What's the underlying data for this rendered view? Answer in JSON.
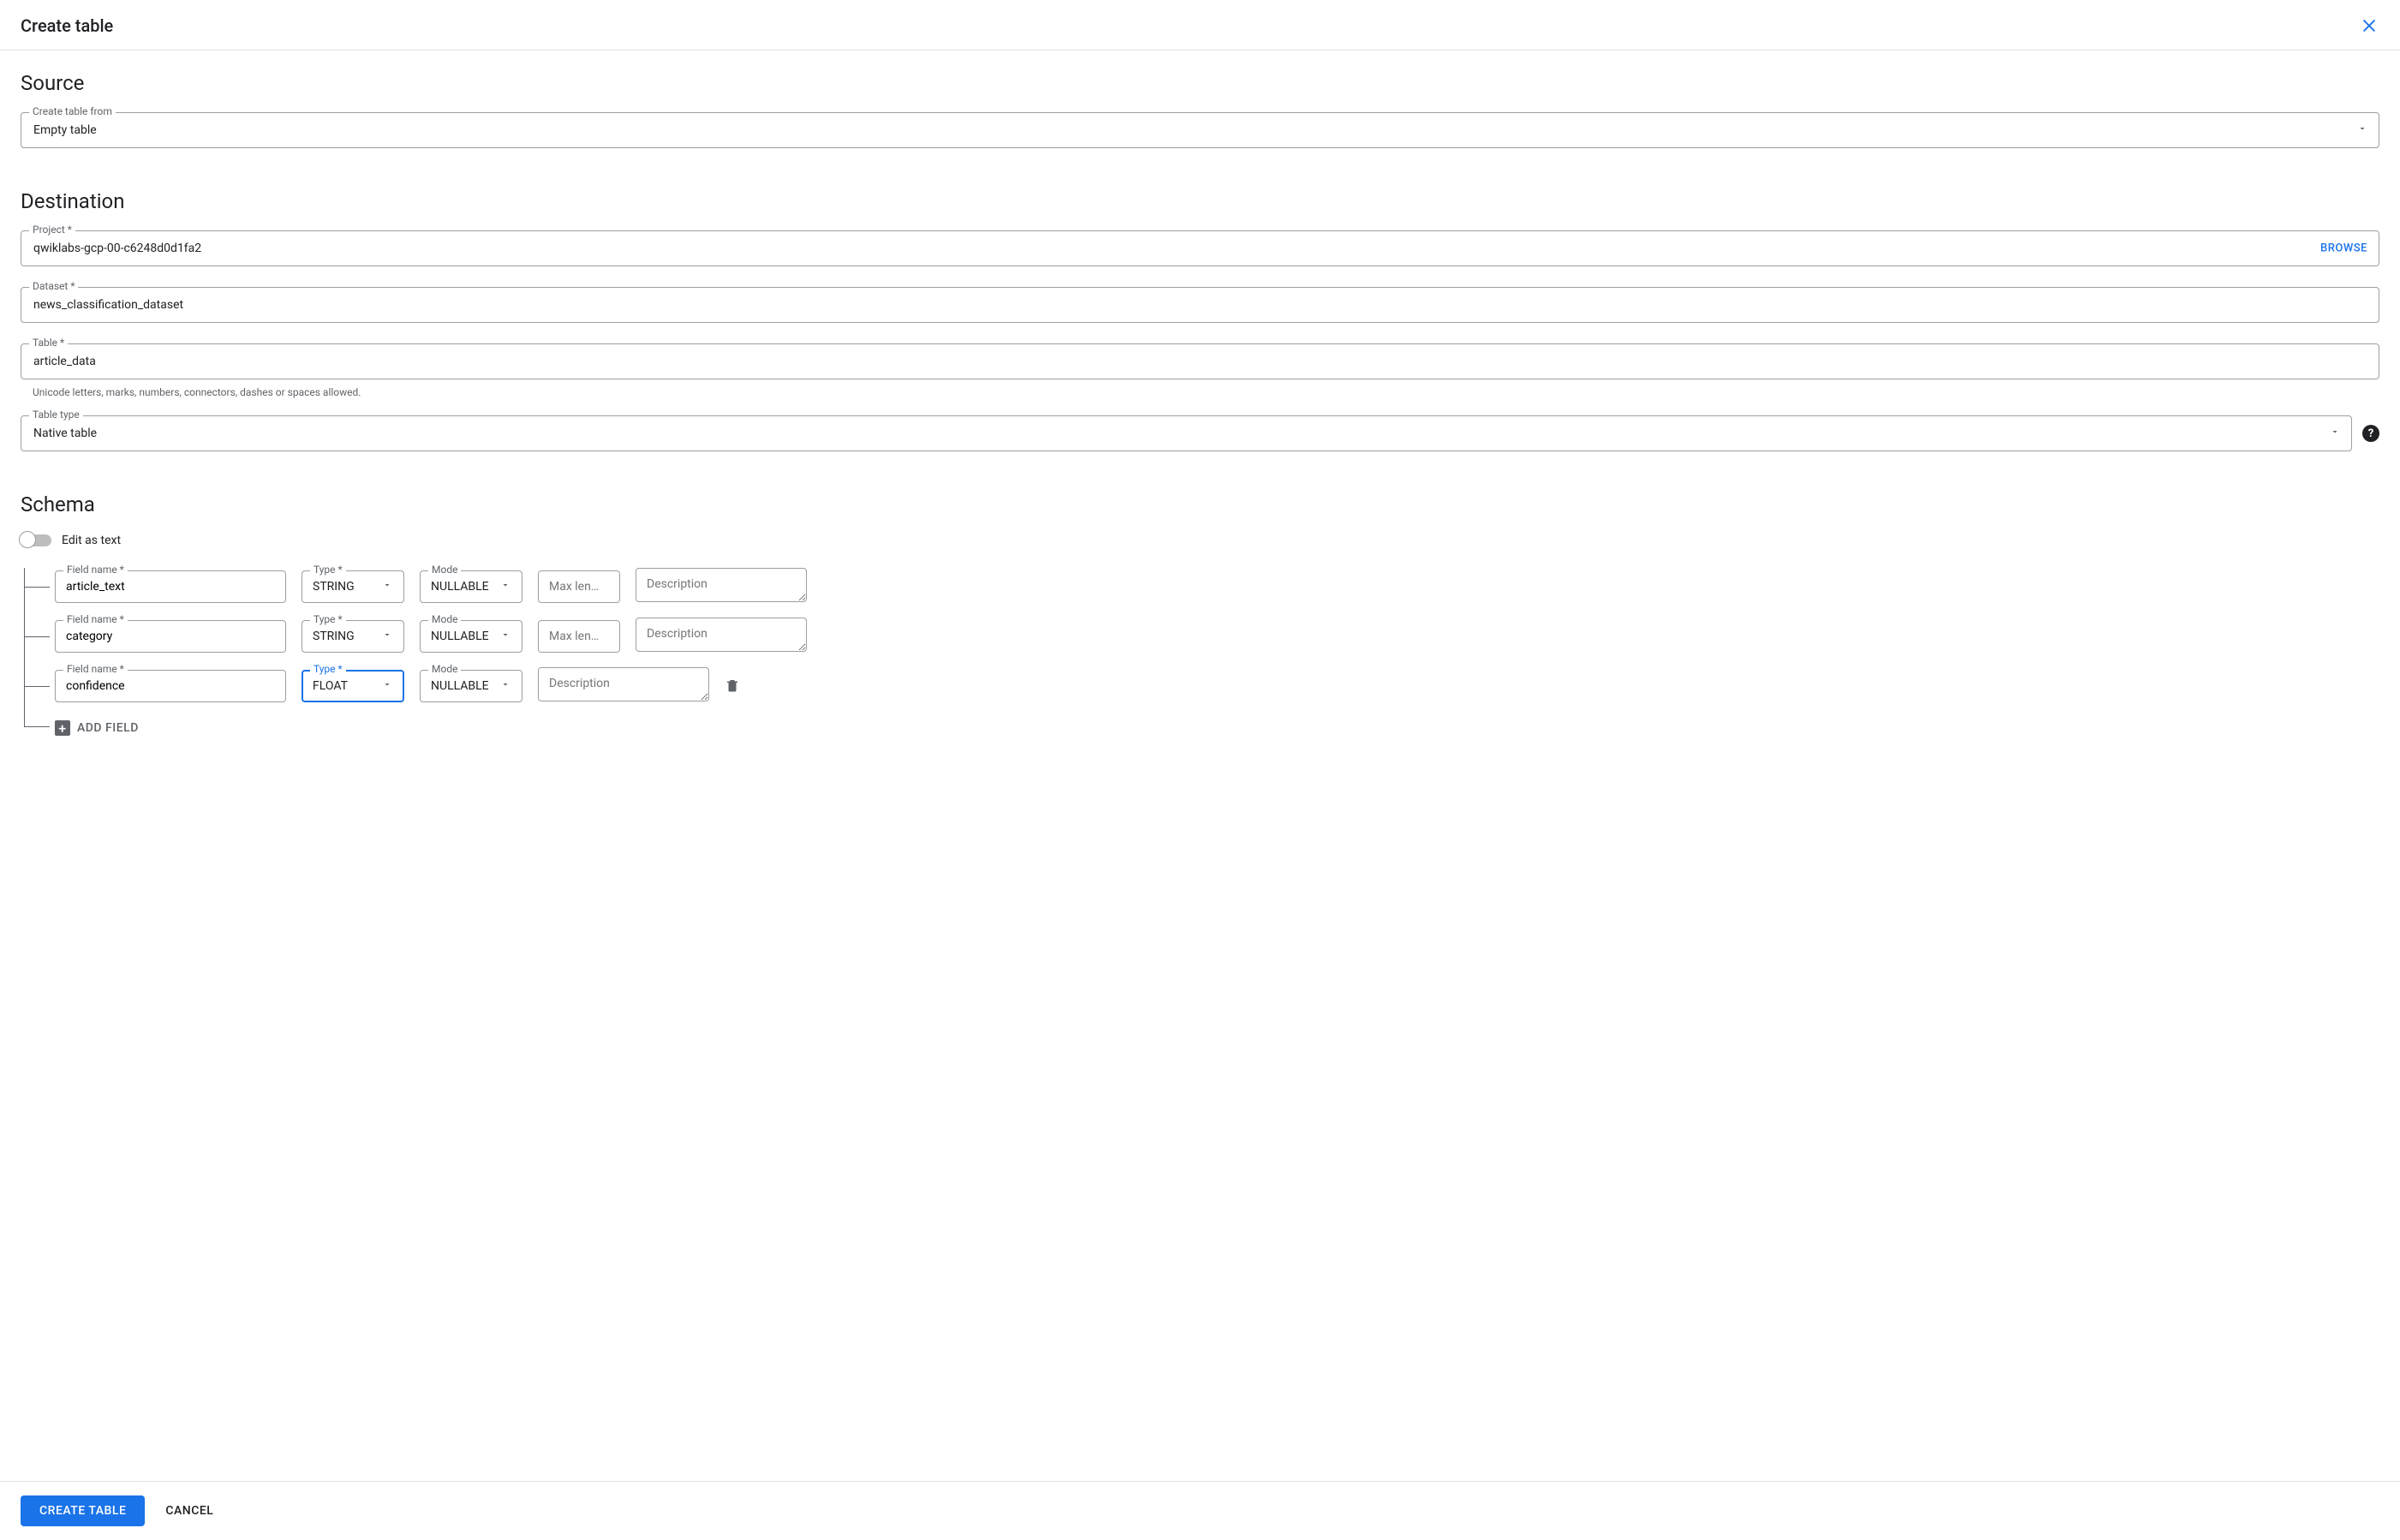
{
  "dialog": {
    "title": "Create table"
  },
  "source": {
    "heading": "Source",
    "create_from_label": "Create table from",
    "create_from_value": "Empty table"
  },
  "destination": {
    "heading": "Destination",
    "project_label": "Project *",
    "project_value": "qwiklabs-gcp-00-c6248d0d1fa2",
    "browse_label": "BROWSE",
    "dataset_label": "Dataset *",
    "dataset_value": "news_classification_dataset",
    "table_label": "Table *",
    "table_value": "article_data",
    "table_helper": "Unicode letters, marks, numbers, connectors, dashes or spaces allowed.",
    "table_type_label": "Table type",
    "table_type_value": "Native table"
  },
  "schema": {
    "heading": "Schema",
    "edit_as_text_label": "Edit as text",
    "field_name_label": "Field name *",
    "type_label": "Type *",
    "mode_label": "Mode",
    "maxlen_placeholder": "Max len…",
    "description_placeholder": "Description",
    "add_field_label": "ADD FIELD",
    "fields": [
      {
        "name": "article_text",
        "type": "STRING",
        "mode": "NULLABLE",
        "focused": false,
        "has_maxlen": true,
        "deletable": false
      },
      {
        "name": "category",
        "type": "STRING",
        "mode": "NULLABLE",
        "focused": false,
        "has_maxlen": true,
        "deletable": false
      },
      {
        "name": "confidence",
        "type": "FLOAT",
        "mode": "NULLABLE",
        "focused": true,
        "has_maxlen": false,
        "deletable": true
      }
    ]
  },
  "footer": {
    "create_label": "CREATE TABLE",
    "cancel_label": "CANCEL"
  }
}
